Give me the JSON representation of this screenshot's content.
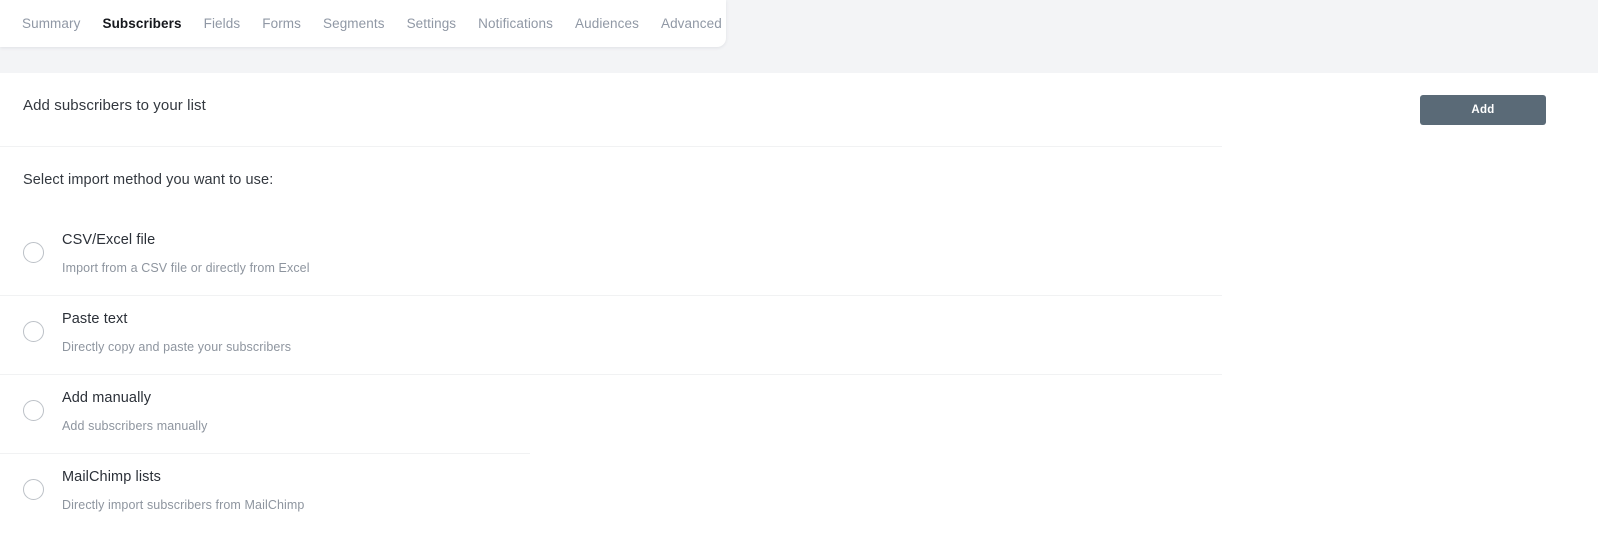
{
  "tabs": [
    {
      "label": "Summary",
      "active": false
    },
    {
      "label": "Subscribers",
      "active": true
    },
    {
      "label": "Fields",
      "active": false
    },
    {
      "label": "Forms",
      "active": false
    },
    {
      "label": "Segments",
      "active": false
    },
    {
      "label": "Settings",
      "active": false
    },
    {
      "label": "Notifications",
      "active": false
    },
    {
      "label": "Audiences",
      "active": false
    },
    {
      "label": "Advanced",
      "active": false
    }
  ],
  "header": {
    "title": "Add subscribers to your list",
    "add_label": "Add"
  },
  "body": {
    "prompt": "Select import method you want to use:",
    "options": [
      {
        "label": "CSV/Excel file",
        "description": "Import from a CSV file or directly from Excel",
        "selected": false,
        "divider_width": 1222
      },
      {
        "label": "Paste text",
        "description": "Directly copy and paste your subscribers",
        "selected": false,
        "divider_width": 1222
      },
      {
        "label": "Add manually",
        "description": "Add subscribers manually",
        "selected": false,
        "divider_width": 530
      },
      {
        "label": "MailChimp lists",
        "description": "Directly import subscribers from MailChimp",
        "selected": false,
        "divider_width": 0
      }
    ]
  },
  "colors": {
    "band_background": "#f3f4f6",
    "card_background": "#ffffff",
    "tab_inactive": "#9098a5",
    "tab_active": "#16181d",
    "button_background": "#5a6a77",
    "button_text": "#ffffff",
    "text_primary": "#2b3038",
    "text_muted": "#8e959f",
    "divider": "#f1f2f3",
    "radio_border": "#bcc1c7"
  }
}
